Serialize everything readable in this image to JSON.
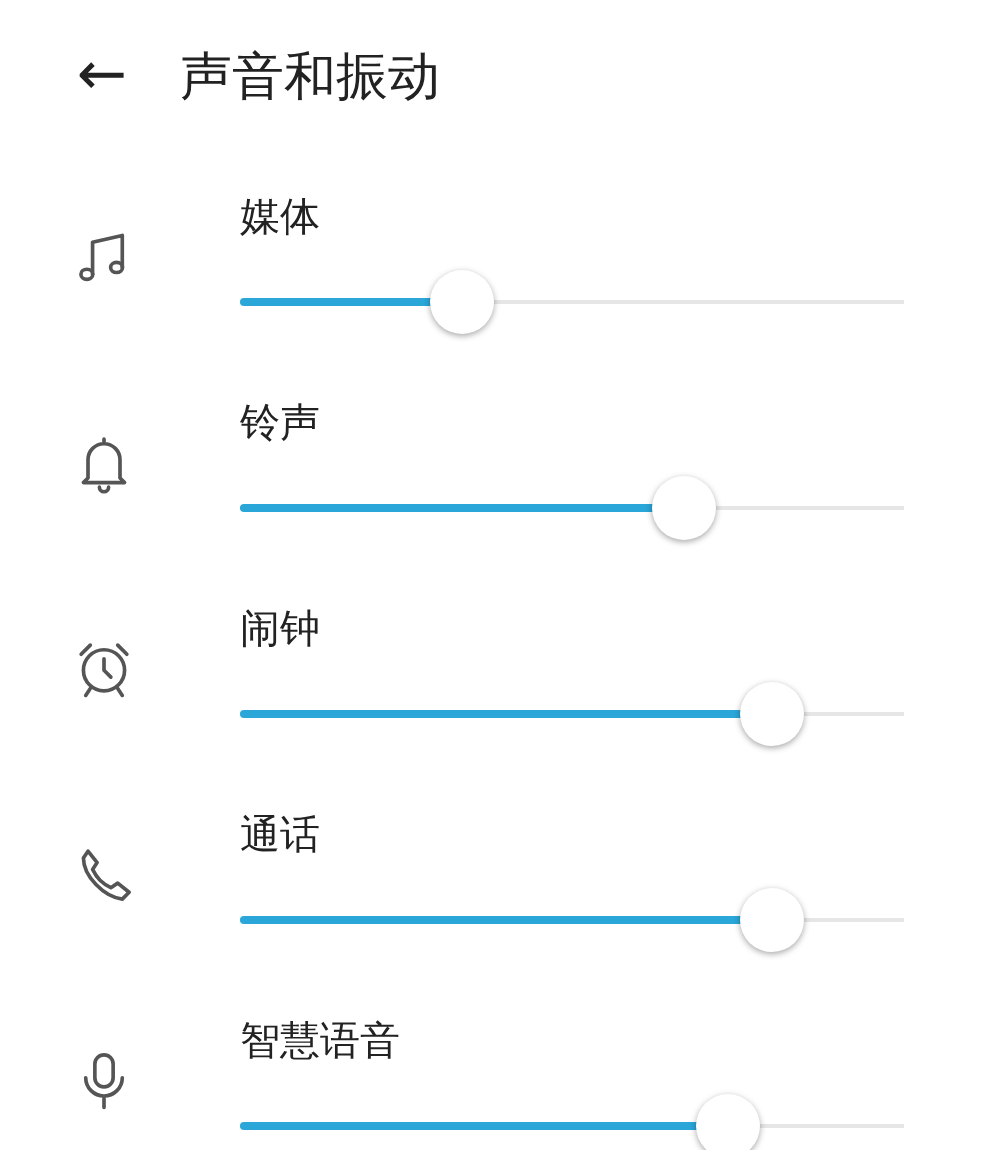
{
  "header": {
    "back": "←",
    "title": "声音和振动"
  },
  "volumes": [
    {
      "kind": "music",
      "label": "媒体",
      "level": 0.334
    },
    {
      "kind": "bell",
      "label": "铃声",
      "level": 0.669
    },
    {
      "kind": "alarm",
      "label": "闹钟",
      "level": 0.8
    },
    {
      "kind": "phone",
      "label": "通话",
      "level": 0.8
    },
    {
      "kind": "mic",
      "label": "智慧语音",
      "level": 0.735
    }
  ]
}
